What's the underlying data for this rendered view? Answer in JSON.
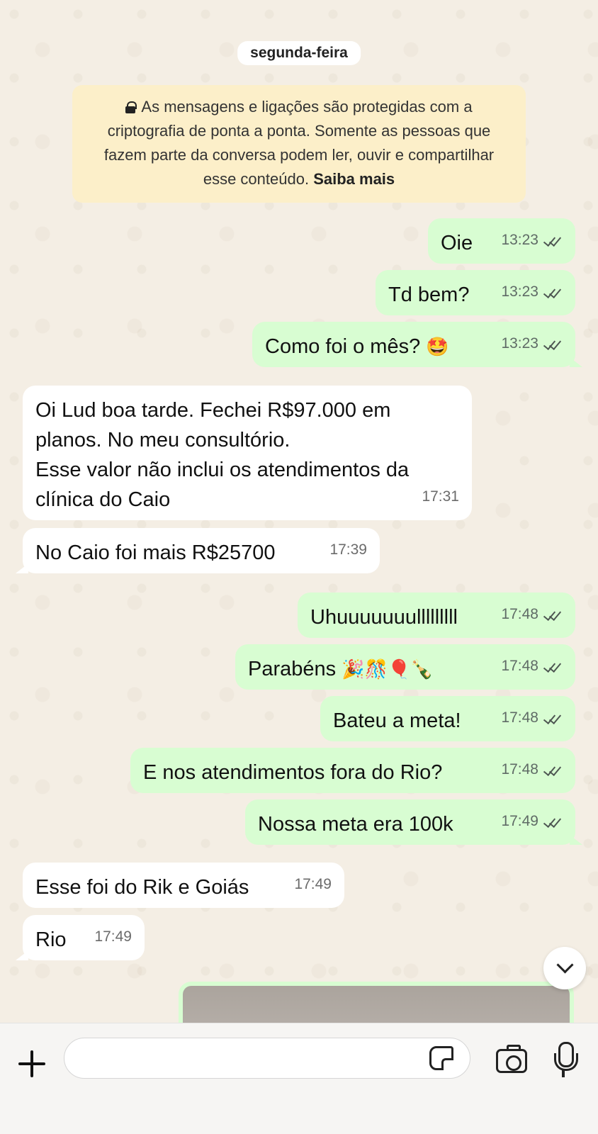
{
  "date_separator": "segunda-feira",
  "encryption_notice": {
    "text": "As mensagens e ligações são protegidas com a criptografia de ponta a ponta. Somente as pessoas que fazem parte da conversa podem ler, ouvir e compartilhar esse conteúdo.",
    "link": "Saiba mais"
  },
  "messages": [
    {
      "dir": "out",
      "text": "Oie",
      "time": "13:23",
      "status": "read"
    },
    {
      "dir": "out",
      "text": "Td bem?",
      "time": "13:23",
      "status": "read"
    },
    {
      "dir": "out",
      "text": "Como foi o mês?",
      "emoji": "🤩",
      "time": "13:23",
      "status": "read"
    },
    {
      "dir": "in",
      "lines": [
        "Oi Lud boa tarde. Fechei R$97.000 em",
        "planos. No meu consultório.",
        "Esse valor não inclui os atendimentos da",
        "clínica do Caio"
      ],
      "time": "17:31"
    },
    {
      "dir": "in",
      "text": "No Caio foi mais R$25700",
      "time": "17:39"
    },
    {
      "dir": "out",
      "text": "Uhuuuuuuulllllllll",
      "time": "17:48",
      "status": "read"
    },
    {
      "dir": "out",
      "text": "Parabéns",
      "emoji": "🎉🎊🎈🍾",
      "time": "17:48",
      "status": "read"
    },
    {
      "dir": "out",
      "text": "Bateu a meta!",
      "time": "17:48",
      "status": "read"
    },
    {
      "dir": "out",
      "text": "E nos atendimentos fora do Rio?",
      "time": "17:48",
      "status": "read"
    },
    {
      "dir": "out",
      "text": "Nossa meta era 100k",
      "time": "17:49",
      "status": "read"
    },
    {
      "dir": "in",
      "text": "Esse foi do Rik e Goiás",
      "time": "17:49"
    },
    {
      "dir": "in",
      "text": "Rio",
      "time": "17:49"
    }
  ],
  "icons": {
    "attach": "plus-icon",
    "sticker": "sticker-icon",
    "camera": "camera-icon",
    "mic": "microphone-icon",
    "scroll": "chevron-down-icon",
    "read_receipt": "double-check-icon",
    "lock": "lock-icon"
  },
  "colors": {
    "outgoing_bubble": "#d8fdd2",
    "incoming_bubble": "#ffffff",
    "notice_bg": "#fcefc9",
    "wallpaper": "#f4eee4"
  }
}
